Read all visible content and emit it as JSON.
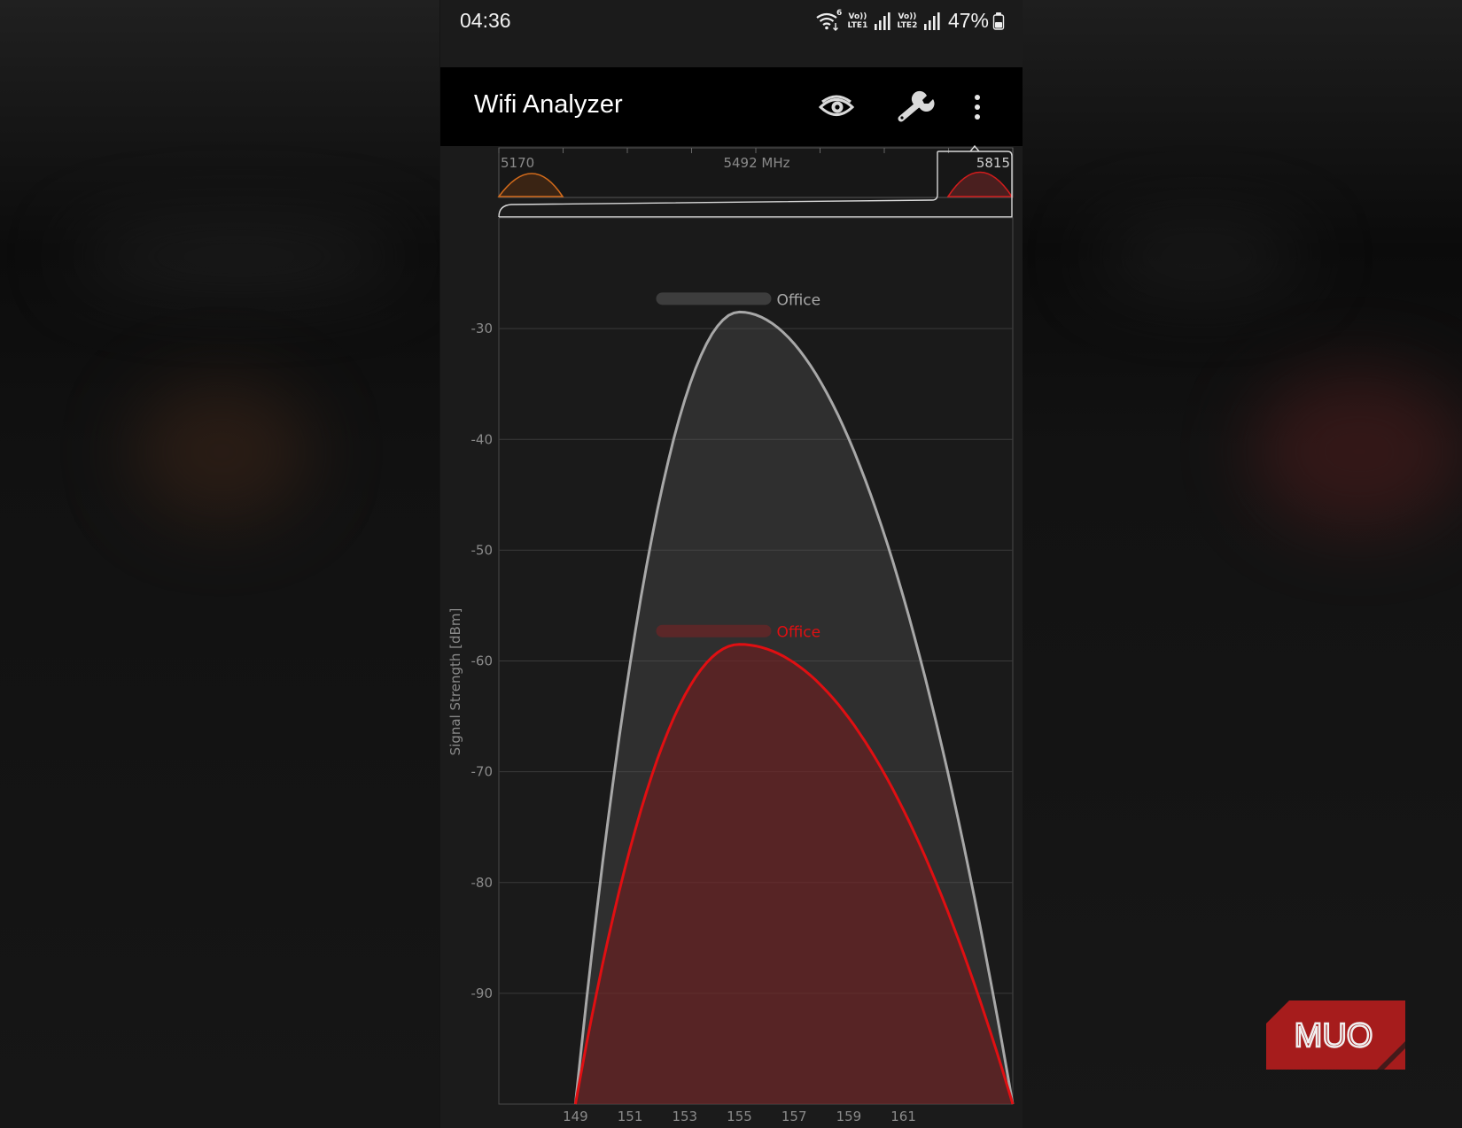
{
  "status_bar": {
    "time": "04:36",
    "battery": "47%",
    "sim1_label": "LTE1",
    "sim2_label": "LTE2",
    "volte_label": "Vo))",
    "wifi_badge": "6",
    "icons": [
      "wifi6-icon",
      "volte-lte1-icon",
      "signal-bars-icon",
      "volte-lte2-icon",
      "signal-bars-icon",
      "battery-icon"
    ]
  },
  "app_bar": {
    "title": "Wifi Analyzer",
    "actions": [
      "eye-icon",
      "wrench-icon",
      "more-vert-icon"
    ]
  },
  "overview": {
    "freq_start": "5170",
    "freq_center": "5492 MHz",
    "freq_end": "5815"
  },
  "watermark": "MUO",
  "colors": {
    "network_primary": "#a8a8a8",
    "network_secondary": "#e00f12",
    "overview_orange": "#d16a1b",
    "overview_red": "#d11c1c",
    "watermark_red": "#b31d1d"
  },
  "chart_data": {
    "type": "area",
    "ylabel": "Signal Strength [dBm]",
    "xlabel": "",
    "yticks": [
      -30,
      -40,
      -50,
      -60,
      -70,
      -80,
      -90
    ],
    "ylim": [
      -100,
      -20
    ],
    "xticks": [
      149,
      151,
      153,
      155,
      157,
      159,
      161
    ],
    "xlim": [
      146.2,
      165
    ],
    "grid": true,
    "series": [
      {
        "name": "Office",
        "center_channel": 155,
        "peak_dbm": -28.5,
        "span_channels": [
          149,
          165
        ],
        "color": "#a8a8a8"
      },
      {
        "name": "Office",
        "center_channel": 155,
        "peak_dbm": -58.5,
        "span_channels": [
          149,
          165
        ],
        "color": "#e00f12"
      }
    ]
  }
}
